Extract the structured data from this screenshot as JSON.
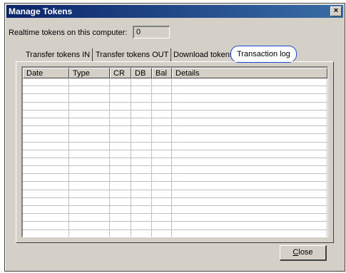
{
  "window": {
    "title": "Manage Tokens",
    "close_glyph": "×"
  },
  "realtime": {
    "label": "Realtime tokens on this computer:",
    "value": "0"
  },
  "tabs": [
    {
      "label": "Transfer tokens IN",
      "active": false
    },
    {
      "label": "Transfer tokens OUT",
      "active": false
    },
    {
      "label": "Download tokens",
      "active": false
    },
    {
      "label": "Transaction log",
      "active": true
    }
  ],
  "table": {
    "columns": [
      "Date",
      "Type",
      "CR",
      "DB",
      "Bal",
      "Details"
    ],
    "rows": []
  },
  "buttons": {
    "close_first": "C",
    "close_rest": "lose"
  }
}
